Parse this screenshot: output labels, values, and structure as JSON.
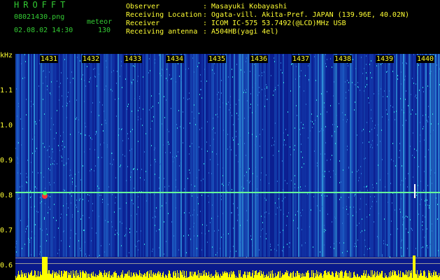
{
  "header": {
    "brand": "HROFFT",
    "filename": "08021430.png",
    "datetime": "02.08.02 14:30",
    "mode_label": "meteor",
    "count": "130"
  },
  "info": [
    {
      "label": "Observer",
      "value": ": Masayuki Kobayashi"
    },
    {
      "label": "Receiving Location",
      "value": ": Ogata-vill. Akita-Pref. JAPAN (139.96E, 40.02N)"
    },
    {
      "label": "Receiver",
      "value": ": ICOM IC-575 53.7492(@LCD)MHz USB"
    },
    {
      "label": "Receiving antenna",
      "value": ": A504HB(yagi 4el)"
    }
  ],
  "axis": {
    "unit": "kHz",
    "ticks": [
      "1.1",
      "1.0",
      "0.9",
      "0.8",
      "0.7",
      "0.6"
    ]
  },
  "minutes": [
    "1431",
    "1432",
    "1433",
    "1434",
    "1435",
    "1436",
    "1437",
    "1438",
    "1439",
    "1440"
  ],
  "colors": {
    "label_yellow": "#ffff33",
    "brand_green": "#33cc33",
    "background": "#000000",
    "spectrogram_base": "#0a1a8c",
    "carrier": "#66ff99"
  }
}
